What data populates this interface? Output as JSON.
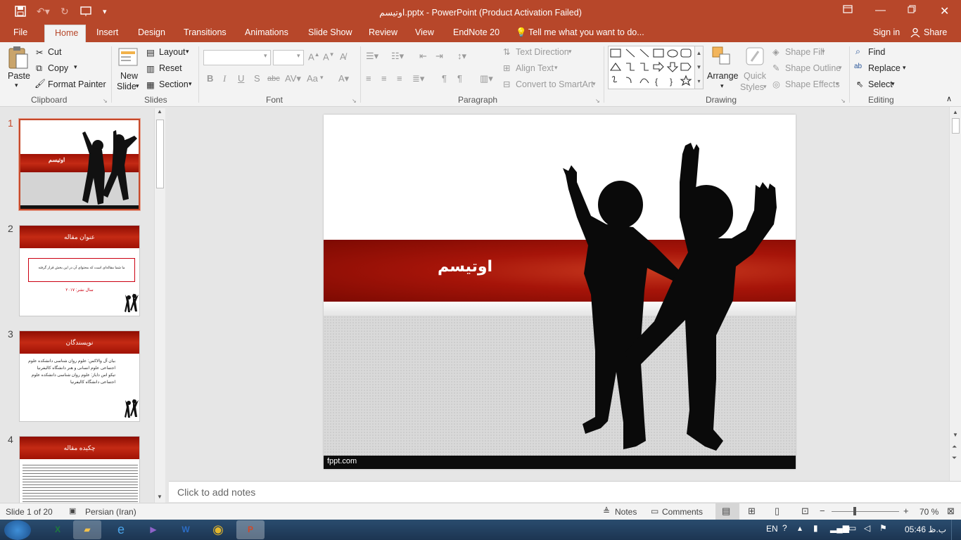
{
  "window": {
    "title": "اوتیسم.pptx - PowerPoint (Product Activation Failed)",
    "quick_access": [
      "save-icon",
      "undo-icon",
      "redo-icon",
      "present-icon",
      "customize-icon"
    ],
    "controls": [
      "restore-ribbon-icon",
      "minimize-icon",
      "maximize-icon",
      "close-icon"
    ]
  },
  "tabs": {
    "file": "File",
    "home": "Home",
    "insert": "Insert",
    "design": "Design",
    "transitions": "Transitions",
    "animations": "Animations",
    "slideshow": "Slide Show",
    "review": "Review",
    "view": "View",
    "endnote": "EndNote 20",
    "tell": "Tell me what you want to do...",
    "signin": "Sign in",
    "share": "Share"
  },
  "ribbon": {
    "clipboard": {
      "paste": "Paste",
      "cut": "Cut",
      "copy": "Copy",
      "format_painter": "Format Painter",
      "group": "Clipboard"
    },
    "slides": {
      "new": "New",
      "slide": "Slide",
      "layout": "Layout",
      "reset": "Reset",
      "section": "Section",
      "group": "Slides"
    },
    "font": {
      "group": "Font",
      "bold": "B",
      "italic": "I",
      "underline": "U",
      "shadow": "S",
      "strike": "abc",
      "case": "Aa"
    },
    "paragraph": {
      "text_direction": "Text Direction",
      "align_text": "Align Text",
      "convert": "Convert to SmartArt",
      "group": "Paragraph"
    },
    "drawing": {
      "arrange": "Arrange",
      "quick": "Quick",
      "styles": "Styles",
      "shape_fill": "Shape Fill",
      "shape_outline": "Shape Outline",
      "shape_effects": "Shape Effects",
      "group": "Drawing"
    },
    "editing": {
      "find": "Find",
      "replace": "Replace",
      "select": "Select",
      "group": "Editing"
    }
  },
  "thumbnails": [
    {
      "num": "1",
      "title": "اوتیسم"
    },
    {
      "num": "2",
      "title": "عنوان مقاله",
      "body": "ما شما مقاله‌ای است که محتوای آن در این بخش قرار گرفته",
      "foot": "سال نشر: ۲۰۱۷"
    },
    {
      "num": "3",
      "title": "نویسندگان",
      "line1": "بیان آل والاکس: علوم روان شناسی دانشکده علوم",
      "line2": "اجتماعی علوم انسانی و هنر دانشگاه کالیفرنیا",
      "line3": "تیکو اس دایاز: علوم روان شناسی دانشکده علوم",
      "line4": "اجتماعی دانشگاه کالیفرنیا"
    },
    {
      "num": "4",
      "title": "چکیده مقاله"
    }
  ],
  "slide": {
    "title": "اوتیسم",
    "footer": "fppt.com"
  },
  "notes_placeholder": "Click to add notes",
  "status": {
    "slide": "Slide 1 of 20",
    "language": "Persian (Iran)",
    "notes": "Notes",
    "comments": "Comments",
    "zoom": "70 %"
  },
  "taskbar": {
    "lang": "EN",
    "time": "05:46 ب.ظ"
  }
}
